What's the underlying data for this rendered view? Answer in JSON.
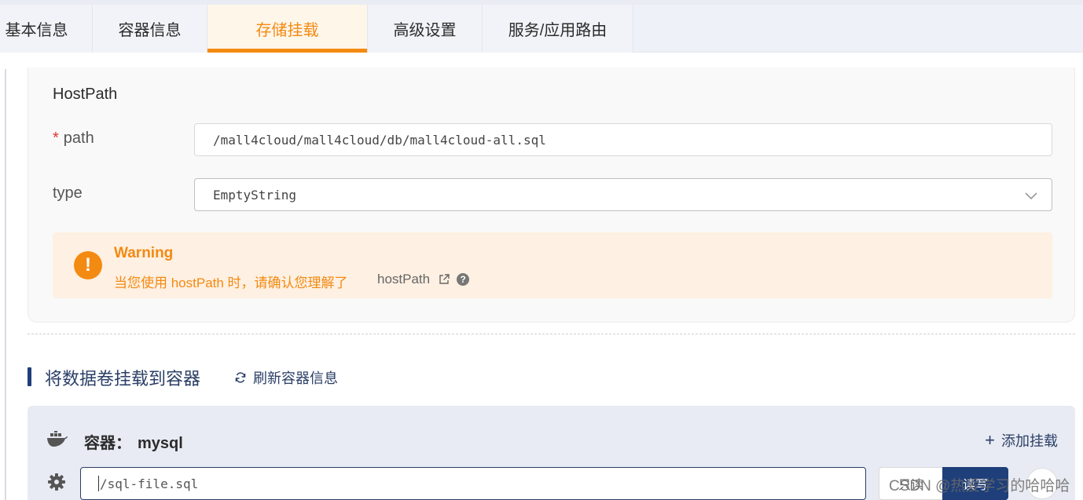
{
  "tabs": [
    {
      "label": "基本信息"
    },
    {
      "label": "容器信息"
    },
    {
      "label": "存储挂载"
    },
    {
      "label": "高级设置"
    },
    {
      "label": "服务/应用路由"
    }
  ],
  "active_tab": "存储挂载",
  "hostpath": {
    "title": "HostPath",
    "path_label": "path",
    "required_mark": "*",
    "path_value": "/mall4cloud/mall4cloud/db/mall4cloud-all.sql",
    "type_label": "type",
    "type_value": "EmptyString"
  },
  "warning": {
    "title": "Warning",
    "message": "当您使用 hostPath 时，请确认您理解了",
    "link_text": "hostPath",
    "icon_glyph": "!",
    "help_glyph": "?"
  },
  "mount_section": {
    "title": "将数据卷挂载到容器",
    "refresh_label": "刷新容器信息"
  },
  "container": {
    "label": "容器：",
    "name": "mysql",
    "add_mount_label": "添加挂载",
    "mount_path_value": "/sql-file.sql",
    "readonly_label": "只读",
    "readwrite_label": "读写"
  },
  "watermark": "CSDN @热爱学习的哈哈哈",
  "colors": {
    "accent_orange": "#f38a12",
    "primary_navy": "#1f3f7a",
    "warning_bg": "#fef0e2"
  }
}
